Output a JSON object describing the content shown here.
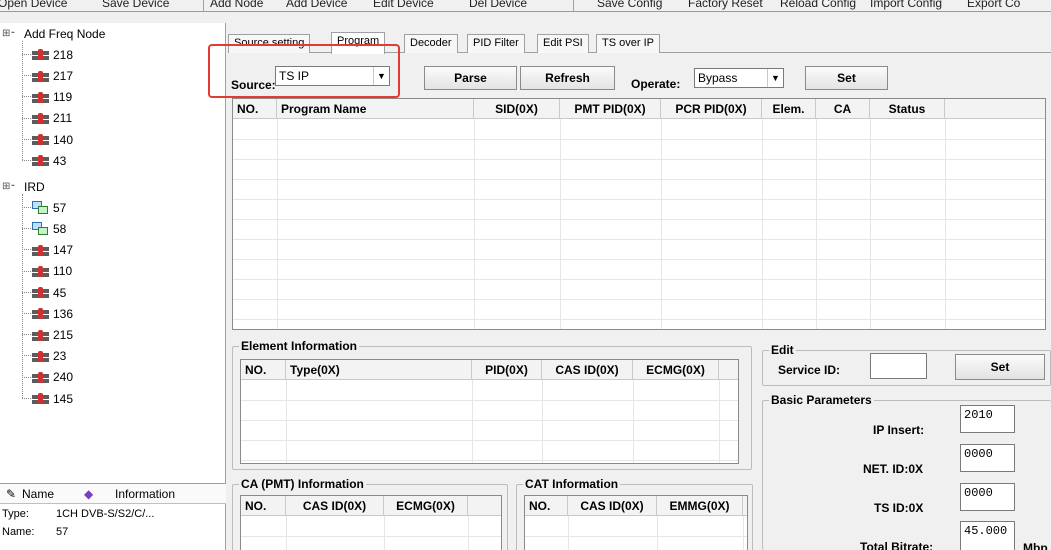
{
  "toolbar": {
    "open_device": "Open Device",
    "save_device": "Save Device",
    "add_node": "Add Node",
    "add_device": "Add Device",
    "edit_device": "Edit Device",
    "del_device": "Del Device",
    "save_config": "Save Config",
    "factory_reset": "Factory Reset",
    "reload_config": "Reload Config",
    "import_config": "Import Config",
    "export_config": "Export Co"
  },
  "tree": {
    "freq_root": "Add Freq Node",
    "freq_items": [
      "218",
      "217",
      "119",
      "211",
      "140",
      "43"
    ],
    "ird_root": "IRD",
    "ird_items": [
      "57",
      "58",
      "147",
      "110",
      "45",
      "136",
      "215",
      "23",
      "240",
      "145"
    ]
  },
  "info": {
    "col_name": "Name",
    "col_info": "Information",
    "type_key": "Type:",
    "type_val": "1CH DVB-S/S2/C/...",
    "name_key": "Name:",
    "name_val": "57"
  },
  "tabs": [
    "Source setting",
    "Program",
    "Decoder",
    "PID Filter",
    "Edit PSI",
    "TS over IP"
  ],
  "controls": {
    "source_label": "Source:",
    "source_value": "TS IP",
    "parse": "Parse",
    "refresh": "Refresh",
    "operate_label": "Operate:",
    "operate_value": "Bypass",
    "set": "Set"
  },
  "program_table": {
    "headers": [
      "NO.",
      "Program Name",
      "SID(0X)",
      "PMT PID(0X)",
      "PCR PID(0X)",
      "Elem.",
      "CA",
      "Status"
    ]
  },
  "element_info": {
    "title": "Element Information",
    "headers": [
      "NO.",
      "Type(0X)",
      "PID(0X)",
      "CAS ID(0X)",
      "ECMG(0X)"
    ]
  },
  "edit": {
    "title": "Edit",
    "service_id_label": "Service ID:",
    "service_id_value": "",
    "set": "Set"
  },
  "basic": {
    "title": "Basic Parameters",
    "ip_insert_label": "IP Insert:",
    "ip_insert_value": "2010",
    "net_id_label": "NET. ID:0X",
    "net_id_value": "0000",
    "ts_id_label": "TS ID:0X",
    "ts_id_value": "0000",
    "bitrate_label": "Total Bitrate:",
    "bitrate_value": "45.000",
    "bitrate_unit": "Mbp"
  },
  "ca_pmt": {
    "title": "CA (PMT) Information",
    "headers": [
      "NO.",
      "CAS ID(0X)",
      "ECMG(0X)"
    ]
  },
  "cat": {
    "title": "CAT Information",
    "headers": [
      "NO.",
      "CAS ID(0X)",
      "EMMG(0X)"
    ]
  }
}
